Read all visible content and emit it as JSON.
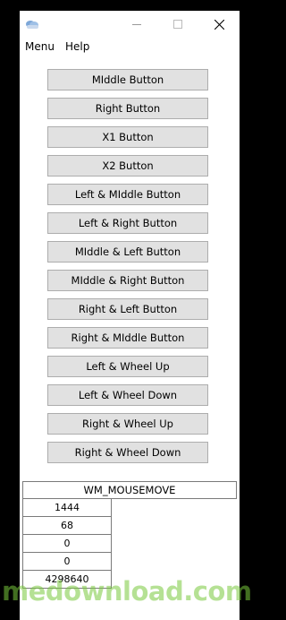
{
  "titlebar": {
    "title": ""
  },
  "menu": [
    "Menu",
    "Help"
  ],
  "buttons": [
    "MIddle Button",
    "Right Button",
    "X1 Button",
    "X2 Button",
    "Left & MIddle Button",
    "Left & Right Button",
    "MIddle & Left Button",
    "MIddle & Right Button",
    "Right & Left Button",
    "Right & MIddle Button",
    "Left & Wheel Up",
    "Left & Wheel Down",
    "Right & Wheel Up",
    "Right & Wheel Down"
  ],
  "event": {
    "message": "WM_MOUSEMOVE"
  },
  "values": [
    "1444",
    "68",
    "0",
    "0",
    "4298640"
  ],
  "watermark": "medownload.com",
  "colors": {
    "button_face": "#e1e1e1",
    "button_border": "#adadad",
    "window": "#ffffff"
  }
}
